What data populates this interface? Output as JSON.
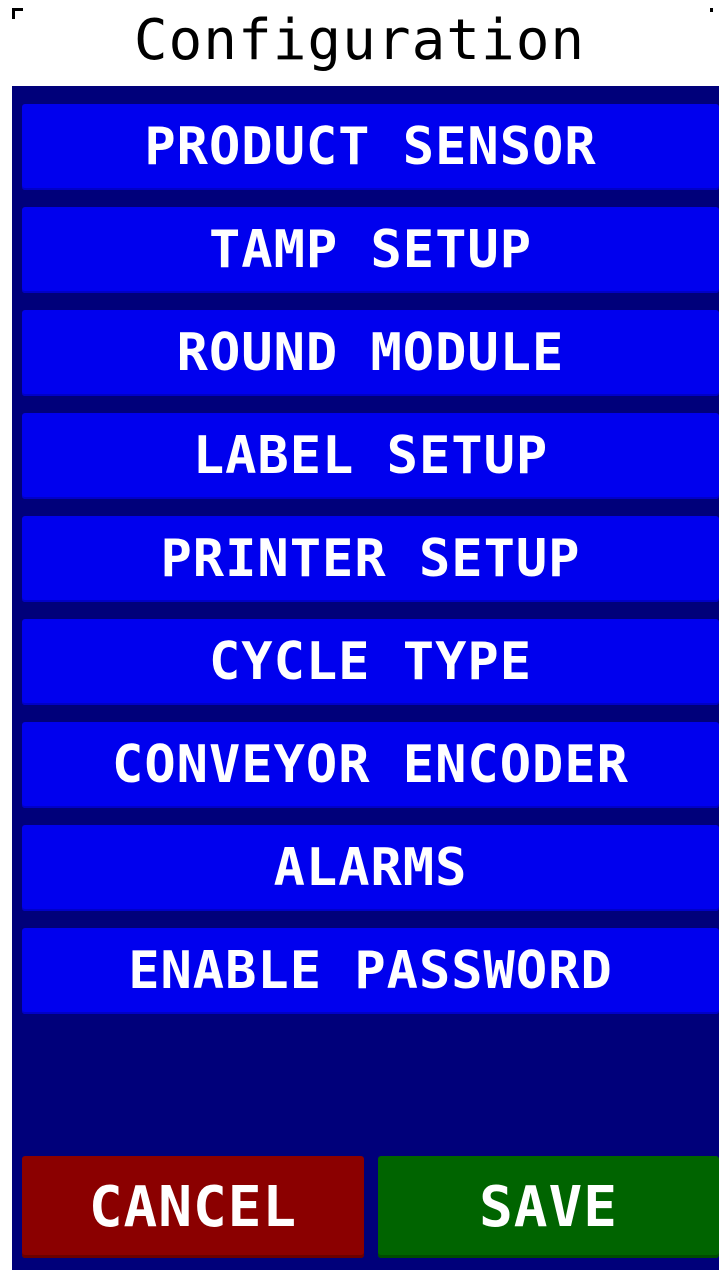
{
  "header": {
    "title": "Configuration"
  },
  "menu": {
    "items": [
      {
        "label": "PRODUCT SENSOR"
      },
      {
        "label": "TAMP SETUP"
      },
      {
        "label": "ROUND MODULE"
      },
      {
        "label": "LABEL SETUP"
      },
      {
        "label": "PRINTER SETUP"
      },
      {
        "label": "CYCLE TYPE"
      },
      {
        "label": "CONVEYOR ENCODER"
      },
      {
        "label": "ALARMS"
      },
      {
        "label": "ENABLE PASSWORD"
      }
    ]
  },
  "footer": {
    "cancel_label": "CANCEL",
    "save_label": "SAVE"
  },
  "colors": {
    "panel_background": "#00007a",
    "menu_item": "#0000ee",
    "cancel": "#8b0000",
    "save": "#006400",
    "title_text": "#000000",
    "button_text": "#ffffff"
  }
}
